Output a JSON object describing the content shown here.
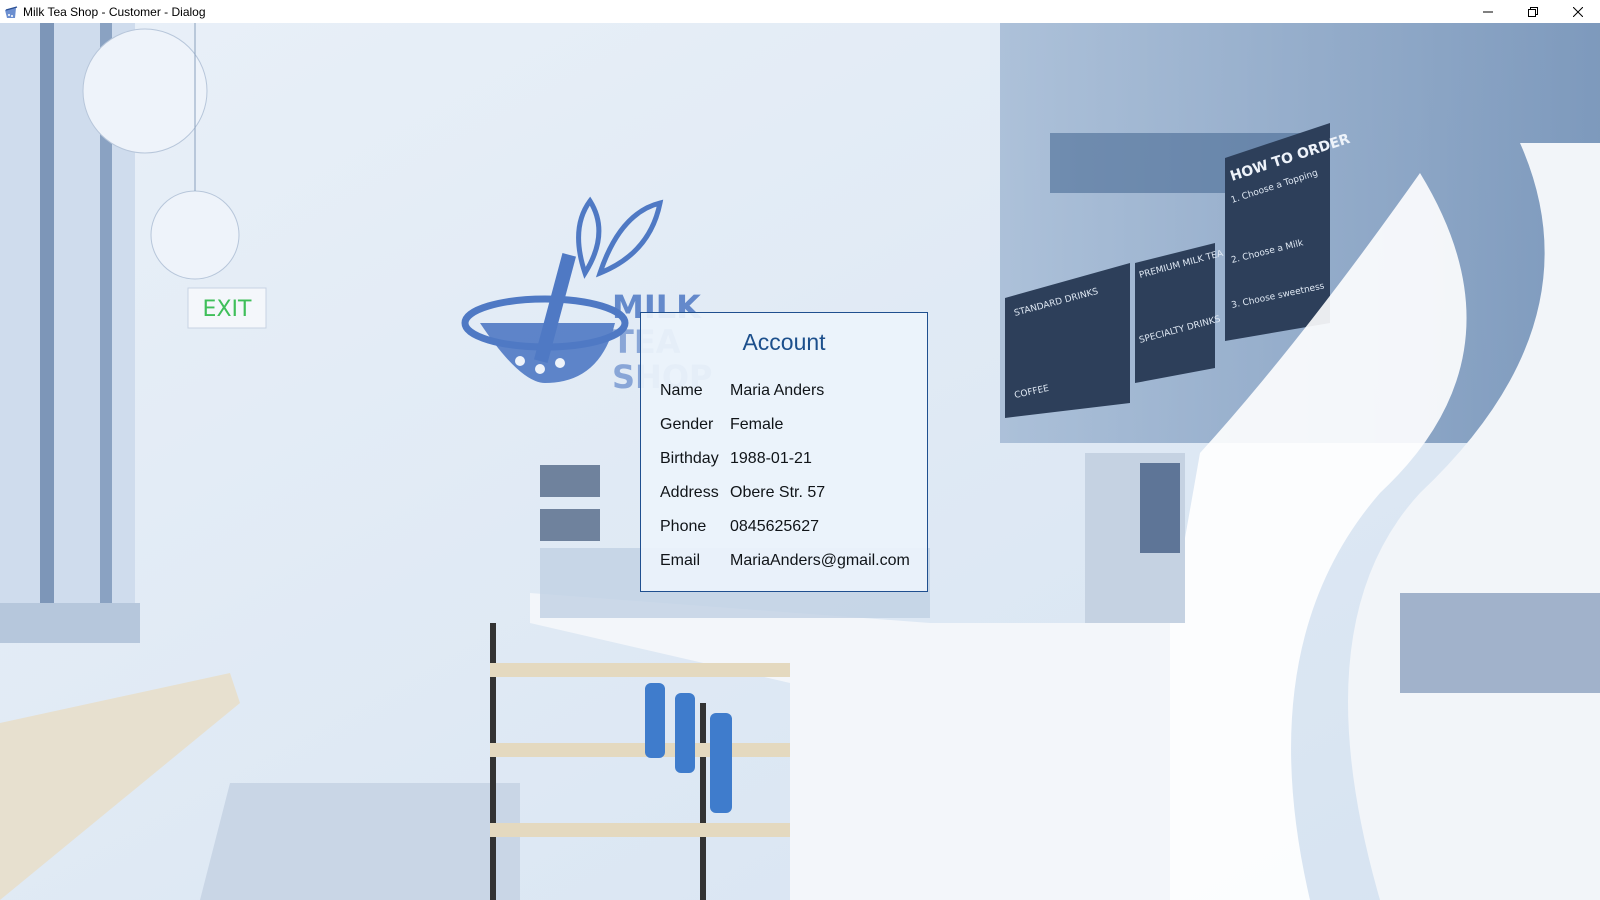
{
  "window": {
    "title": "Milk Tea Shop - Customer - Dialog",
    "app_icon": "milk-tea-app-icon",
    "controls": [
      "minimize-icon",
      "restore-icon",
      "close-icon"
    ]
  },
  "background": {
    "logo_text": [
      "MILK",
      "TEA",
      "SHOP"
    ],
    "exit_sign": "EXIT",
    "menu_board_title": "HOW TO ORDER",
    "menu_board_steps": [
      "1. Choose a Topping",
      "2. Choose a Milk",
      "3. Choose sweetness"
    ],
    "menu_section_1": "STANDARD DRINKS",
    "menu_section_2": "PREMIUM MILK TEA",
    "menu_section_3": "SPECIALTY DRINKS",
    "menu_section_4": "COFFEE"
  },
  "account": {
    "title": "Account",
    "fields": [
      {
        "label": "Name",
        "value": "Maria Anders"
      },
      {
        "label": "Gender",
        "value": "Female"
      },
      {
        "label": "Birthday",
        "value": "1988-01-21"
      },
      {
        "label": "Address",
        "value": "Obere Str. 57"
      },
      {
        "label": "Phone",
        "value": "0845625627"
      },
      {
        "label": "Email",
        "value": "MariaAnders@gmail.com"
      }
    ]
  },
  "colors": {
    "accent": "#1c4f8c",
    "dialog_border": "#1f4f8f",
    "logo_blue": "#4f79c4",
    "exit_green": "#3fbf5a"
  }
}
